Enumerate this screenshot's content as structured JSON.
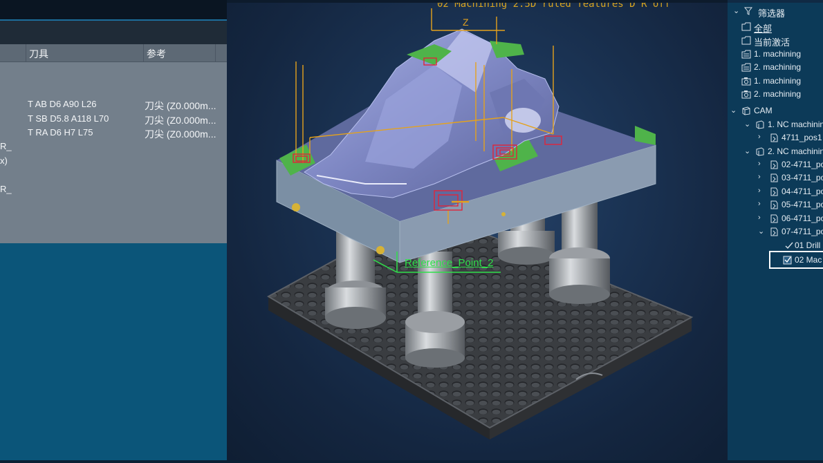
{
  "tool_table": {
    "columns": [
      "",
      "刀具",
      "参考",
      ""
    ],
    "rows": [
      {
        "tool": "T AB D6 A90 L26",
        "ref": "刀尖 (Z0.000m..."
      },
      {
        "tool": "T SB D5.8 A118 L70",
        "ref": "刀尖 (Z0.000m..."
      },
      {
        "tool": "T RA D6 H7 L75",
        "ref": "刀尖 (Z0.000m..."
      }
    ],
    "left_fragments": [
      "R_",
      "x)",
      "R_"
    ]
  },
  "viewport": {
    "title": "02 Machining 2.5D ruled features D R off",
    "axis_label": "Z",
    "reference_point_label": "Reference_Point_2"
  },
  "tree": {
    "filter_label": "筛选器",
    "items": [
      {
        "label": "全部",
        "icon": "folder-icon"
      },
      {
        "label": "当前激活",
        "icon": "folder-icon"
      },
      {
        "label": "1. machining",
        "icon": "folder-icon"
      },
      {
        "label": "2. machining",
        "icon": "folder-icon"
      },
      {
        "label": "1. machining",
        "icon": "camera-icon"
      },
      {
        "label": "2. machining",
        "icon": "camera-icon"
      },
      {
        "label": "CAM",
        "icon": "cube-icon"
      },
      {
        "label": "1. NC machinin",
        "icon": "nc-program-icon"
      },
      {
        "label": "4711_pos1",
        "icon": "operation-icon"
      },
      {
        "label": "2. NC machinin",
        "icon": "nc-program-icon"
      },
      {
        "label": "02-4711_po",
        "icon": "operation-icon"
      },
      {
        "label": "03-4711_po",
        "icon": "operation-icon"
      },
      {
        "label": "04-4711_po",
        "icon": "operation-icon"
      },
      {
        "label": "05-4711_po",
        "icon": "operation-icon"
      },
      {
        "label": "06-4711_po",
        "icon": "operation-icon"
      },
      {
        "label": "07-4711_po",
        "icon": "operation-icon"
      },
      {
        "label": "01 Drill",
        "icon": "check-icon"
      },
      {
        "label": "02 Mac",
        "icon": "check-icon"
      }
    ]
  },
  "colors": {
    "accent_blue": "#0b5579",
    "toolpath_red": "#e0253a",
    "toolpath_yellow": "#e5a21c",
    "reference_green": "#2fe04a",
    "part_blue": "#8f98ce"
  }
}
